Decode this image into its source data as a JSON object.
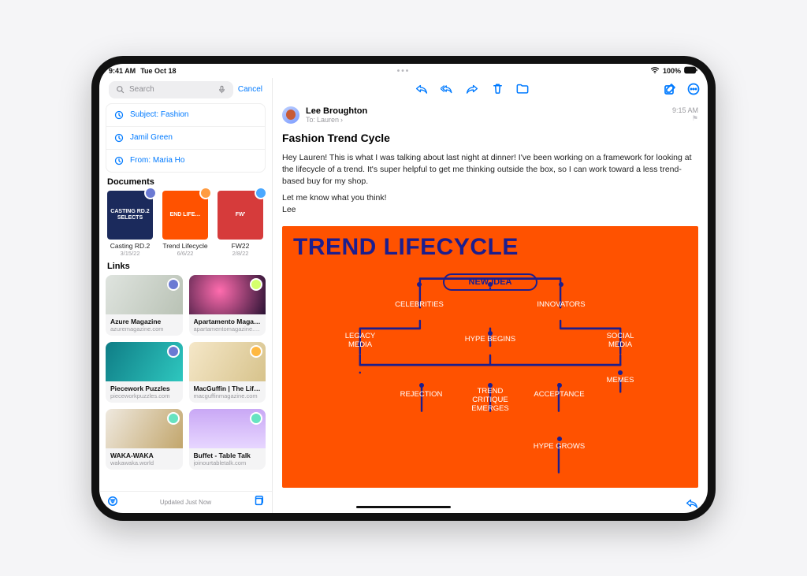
{
  "status": {
    "time": "9:41 AM",
    "date": "Tue Oct 18",
    "battery": "100%"
  },
  "sidebar": {
    "search": {
      "placeholder": "Search",
      "cancel": "Cancel"
    },
    "suggestions": [
      {
        "text": "Subject: Fashion"
      },
      {
        "text": "Jamil Green"
      },
      {
        "text": "From: Maria Ho"
      }
    ],
    "documents_header": "Documents",
    "documents": [
      {
        "title": "Casting RD.2",
        "date": "3/15/22",
        "bg": "#1b2a5c",
        "label": "CASTING RD.2 SELECTS",
        "badge": "#6b7ad3"
      },
      {
        "title": "Trend Lifecycle",
        "date": "6/6/22",
        "bg": "#ff5200",
        "label": "END LIFE…",
        "badge": "#ff9c42"
      },
      {
        "title": "FW22",
        "date": "2/8/22",
        "bg": "#d63b3b",
        "label": "FW'",
        "badge": "#4aa8ff"
      }
    ],
    "links_header": "Links",
    "links": [
      {
        "title": "Azure Magazine",
        "url": "azuremagazine.com",
        "bg": "linear-gradient(120deg,#dfe4df,#b9c2b5)",
        "badge": "#6b7ad3"
      },
      {
        "title": "Apartamento Maga…",
        "url": "apartamentomagazine.c…",
        "bg": "radial-gradient(circle at 40% 40%,#ff6cae,#2a1233)",
        "badge": "#d4ff6b"
      },
      {
        "title": "Piecework Puzzles",
        "url": "pieceworkpuzzles.com",
        "bg": "linear-gradient(120deg,#0f7d86,#2ec7bf)",
        "badge": "#6b7ad3"
      },
      {
        "title": "MacGuffin | The Lif…",
        "url": "macguffinmagazine.com",
        "bg": "linear-gradient(120deg,#f5e7c8,#d7c38c)",
        "badge": "#ffb840"
      },
      {
        "title": "WAKA-WAKA",
        "url": "wakawaka.world",
        "bg": "linear-gradient(120deg,#efe9df,#c2a66c)",
        "badge": "#67e3c1"
      },
      {
        "title": "Buffet - Table Talk",
        "url": "joinourtabletalk.com",
        "bg": "linear-gradient(180deg,#c9a8f5,#e7d6ff)",
        "badge": "#67e3c1"
      }
    ],
    "footer_status": "Updated Just Now"
  },
  "mail": {
    "from": "Lee Broughton",
    "to_label": "To:",
    "to_name": "Lauren",
    "time": "9:15 AM",
    "subject": "Fashion Trend Cycle",
    "paragraph1": "Hey Lauren! This is what I was talking about last night at dinner! I've been working on a framework for looking at the lifecycle of a trend. It's super helpful to get me thinking outside the box, so I can work toward a less trend-based buy for my shop.",
    "paragraph2": "Let me know what you think!",
    "signoff": "Lee"
  },
  "attachment": {
    "title": "TREND LIFECYCLE",
    "new_idea": "NEW IDEA",
    "nodes": {
      "celebrities": "CELEBRITIES",
      "innovators": "INNOVATORS",
      "legacy_media": "LEGACY\nMEDIA",
      "hype_begins": "HYPE BEGINS",
      "social_media": "SOCIAL\nMEDIA",
      "rejection": "REJECTION",
      "critique": "TREND\nCRITIQUE\nEMERGES",
      "acceptance": "ACCEPTANCE",
      "memes": "MEMES",
      "hype_grows": "HYPE GROWS"
    }
  }
}
